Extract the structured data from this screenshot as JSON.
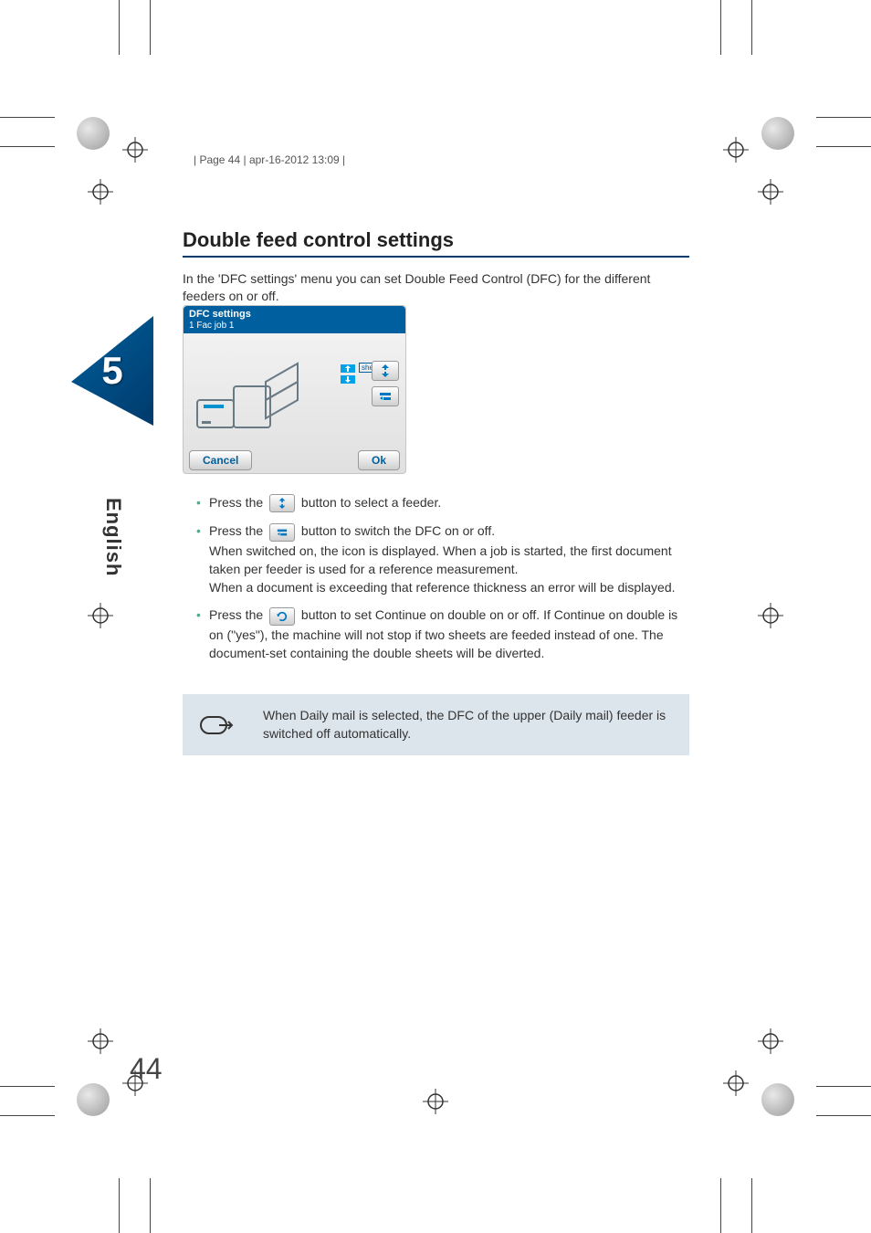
{
  "meta_header": "| Page 44 | apr-16-2012 13:09 |",
  "section_title": "Double feed control settings",
  "intro": "In the 'DFC settings' menu you can set Double Feed Control (DFC) for the different feeders on or off.",
  "panel": {
    "title": "DFC settings",
    "subtitle": "1 Fac job 1",
    "sheets_label": "sheets",
    "cancel": "Cancel",
    "ok": "Ok"
  },
  "chapter_number": "5",
  "language_label": "English",
  "bullets": {
    "b1_pre": "Press the ",
    "b1_post": " button to select a feeder.",
    "b2_pre": "Press the ",
    "b2_mid": " button to switch the DFC on or off.",
    "b2_line2": "When switched on, the icon is displayed. When a job is started, the first document taken per feeder is used for a reference measurement.",
    "b2_line3": "When a document is exceeding that reference thickness an error will be displayed.",
    "b3_pre": "Press the ",
    "b3_post": " button to set Continue on double on or off. If Continue on double is on (\"yes\"), the machine will not stop if two sheets are feeded instead of one. The document-set containing the double sheets will be diverted."
  },
  "note": "When Daily mail is selected, the DFC of the upper (Daily mail) feeder is switched off automatically.",
  "page_number": "44"
}
